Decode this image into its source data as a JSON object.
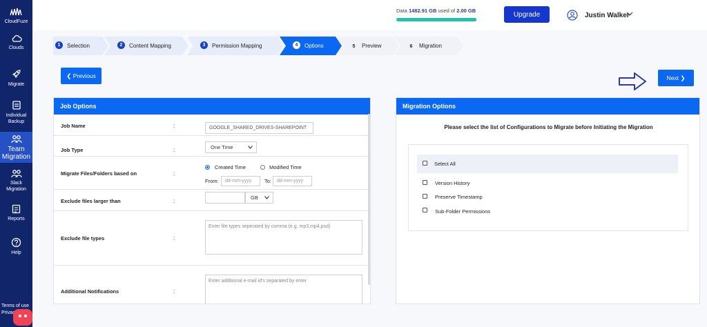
{
  "sidebar": {
    "brand": "CloudFuze",
    "items": [
      {
        "label": "Clouds",
        "icon": "cloud-icon"
      },
      {
        "label": "Migrate",
        "icon": "rocket-icon"
      },
      {
        "label": "Individual Backup",
        "icon": "backup-icon"
      },
      {
        "label": "Team Migration",
        "icon": "team-icon"
      },
      {
        "label": "Slack Migration",
        "icon": "slack-migration-icon"
      },
      {
        "label": "Reports",
        "icon": "reports-icon"
      },
      {
        "label": "Help",
        "icon": "help-icon"
      }
    ],
    "footer_terms": "Terms of use",
    "footer_privacy": "Privacy"
  },
  "header": {
    "data_prefix": "Data",
    "data_used": "1482.91 GB",
    "data_mid": "used of",
    "data_total": "2.00 GB",
    "data_fraction": 0.99,
    "upgrade_label": "Upgrade",
    "user_name": "Justin Walker"
  },
  "steps": [
    {
      "num": "1",
      "label": "Selection",
      "state": "done"
    },
    {
      "num": "2",
      "label": "Content Mapping",
      "state": "done"
    },
    {
      "num": "3",
      "label": "Permission Mapping",
      "state": "done"
    },
    {
      "num": "4",
      "label": "Options",
      "state": "active"
    },
    {
      "num": "5",
      "label": "Preview",
      "state": "todo"
    },
    {
      "num": "6",
      "label": "Migration",
      "state": "todo"
    }
  ],
  "nav": {
    "previous_label": "Previous",
    "next_label": "Next"
  },
  "job_options": {
    "title": "Job Options",
    "colon": ":",
    "job_name_label": "Job Name",
    "job_name_value": "GOOGLE_SHARED_DRIVES-SHAREPOINT",
    "job_type_label": "Job Type",
    "job_type_value": "One Time",
    "migrate_based_label": "Migrate Files/Folders based on",
    "created_time": "Created Time",
    "modified_time": "Modified Time",
    "from_label": "From:",
    "to_label": "To:",
    "date_placeholder": "dd-mm-yyyy",
    "exclude_larger_label": "Exclude files larger than",
    "size_unit": "GB",
    "exclude_types_label": "Exclude file types",
    "exclude_types_placeholder": "Enter file types seperated by comma (e.g. mp3,mp4,psd)",
    "notifications_label": "Additional Notifications",
    "notifications_placeholder": "Enter additional e-mail id's separated by enter"
  },
  "migration_options": {
    "title": "Migration Options",
    "instruction": "Please select the list of Configurations to Migrate before Initiating the Migration",
    "select_all": "Select All",
    "options": [
      "Version History",
      "Preserve Timestamp",
      "Sub-Folder Permissions"
    ]
  }
}
